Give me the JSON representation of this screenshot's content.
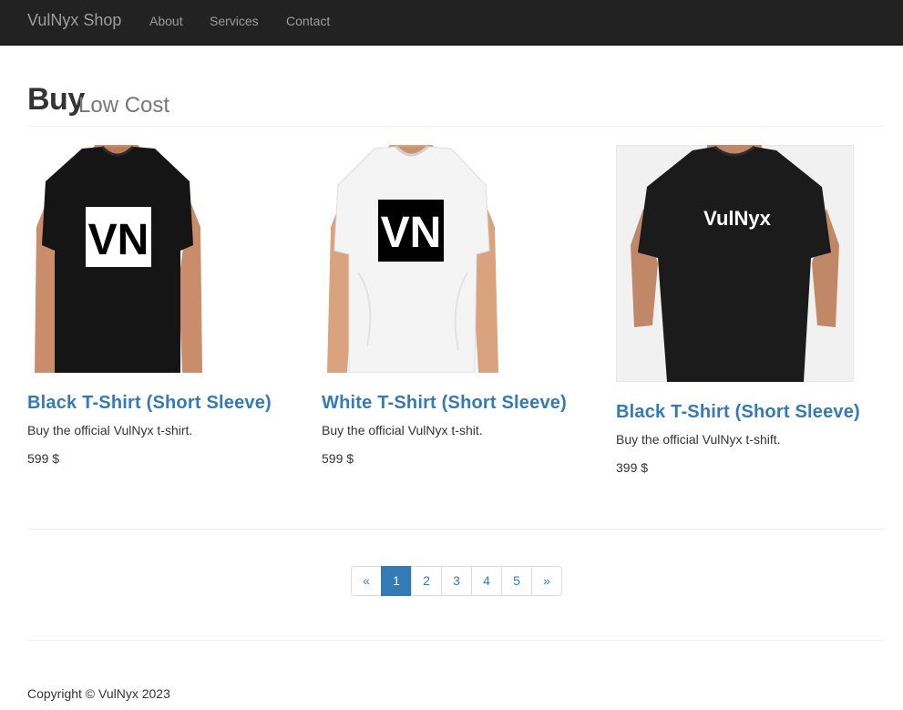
{
  "navbar": {
    "brand": "VulNyx Shop",
    "links": [
      "About",
      "Services",
      "Contact"
    ]
  },
  "header": {
    "title": "Buy",
    "subtitle": "Low Cost"
  },
  "products": [
    {
      "title": "Black T-Shirt (Short Sleeve)",
      "description": "Buy the official VulNyx t-shirt.",
      "price": "599 $",
      "logo_text": "VN",
      "shirt_color": "black"
    },
    {
      "title": "White T-Shirt (Short Sleeve)",
      "description": "Buy the official VulNyx t-shit.",
      "price": "599 $",
      "logo_text": "VN",
      "shirt_color": "white"
    },
    {
      "title": "Black T-Shirt (Short Sleeve)",
      "description": "Buy the official VulNyx t-shift.",
      "price": "399 $",
      "logo_text": "VulNyx",
      "shirt_color": "black"
    }
  ],
  "pagination": {
    "prev": "«",
    "pages": [
      "1",
      "2",
      "3",
      "4",
      "5"
    ],
    "next": "»",
    "active": "1"
  },
  "footer": {
    "copyright": "Copyright © VulNyx 2023"
  },
  "colors": {
    "navbar_bg": "#222222",
    "link": "#337ab7",
    "muted": "#777777"
  }
}
